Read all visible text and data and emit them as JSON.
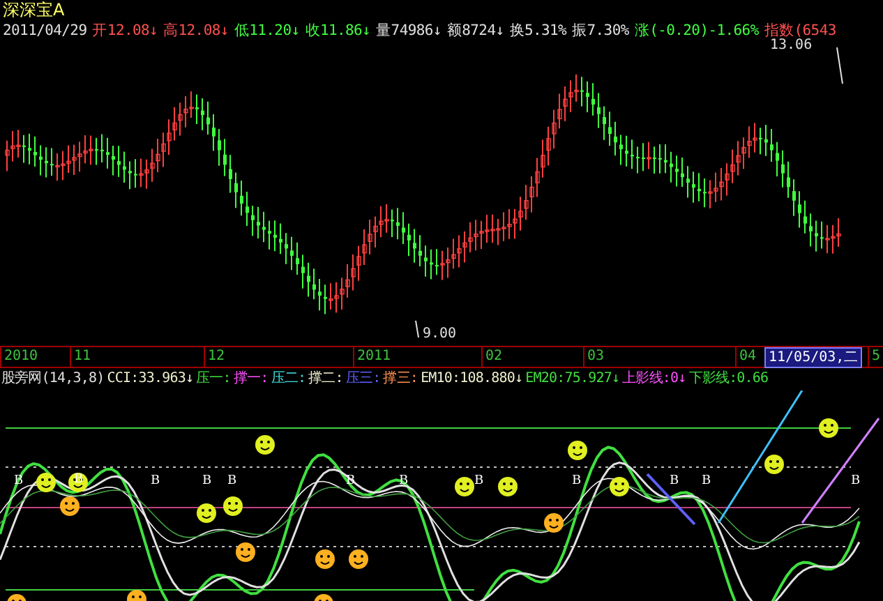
{
  "stock": {
    "name": "深深宝A"
  },
  "quote": [
    {
      "text": "2011/04/29",
      "kind": "flat"
    },
    {
      "text": "开12.08↓",
      "kind": "up"
    },
    {
      "text": "高12.08↓",
      "kind": "up"
    },
    {
      "text": "低11.20↓",
      "kind": "down"
    },
    {
      "text": "收11.86↓",
      "kind": "down"
    },
    {
      "text": "量74986↓",
      "kind": "flat"
    },
    {
      "text": "额8724↓",
      "kind": "flat"
    },
    {
      "text": "换5.31%",
      "kind": "flat"
    },
    {
      "text": "振7.30%",
      "kind": "flat"
    },
    {
      "text": "涨(-0.20)-1.66%",
      "kind": "down"
    },
    {
      "text": "指数(6543",
      "kind": "up"
    }
  ],
  "price_labels": {
    "high": "13.06",
    "low": "9.00"
  },
  "time_axis": {
    "labels": [
      "2010",
      "11",
      "12",
      "2011",
      "02",
      "03",
      "04"
    ],
    "cursor": "11/05/03,二",
    "tail": "5"
  },
  "indicator": {
    "name": "股旁网(14,3,8)",
    "values": [
      {
        "text": "CCI:33.963↓",
        "kind": "white"
      },
      {
        "text": "压一:",
        "kind": "green"
      },
      {
        "text": "撑一:",
        "kind": "magenta"
      },
      {
        "text": "压二:",
        "kind": "cyan"
      },
      {
        "text": "撑二:",
        "kind": "white"
      },
      {
        "text": "压三:",
        "kind": "blue"
      },
      {
        "text": "撑三:",
        "kind": "orange"
      },
      {
        "text": "EM10:108.880↓",
        "kind": "white"
      },
      {
        "text": "EM20:75.927↓",
        "kind": "green"
      },
      {
        "text": "上影线:0↓",
        "kind": "magenta"
      },
      {
        "text": "下影线:0.66",
        "kind": "green"
      }
    ],
    "markers": [
      "B",
      "B",
      "B",
      "B",
      "B",
      "B",
      "B",
      "B",
      "B",
      "B",
      "B",
      "B"
    ]
  }
}
